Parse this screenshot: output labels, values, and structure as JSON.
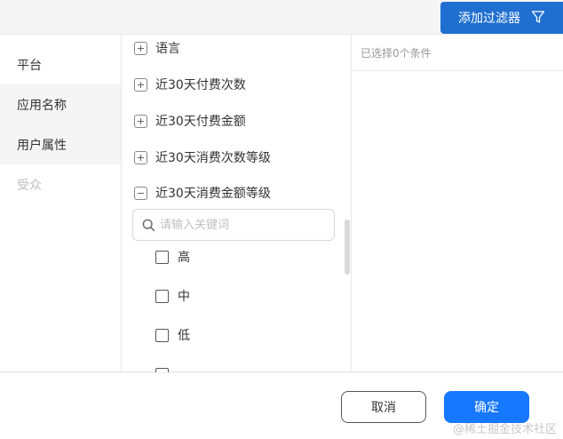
{
  "header": {
    "add_filter_label": "添加过滤器",
    "filter_icon": "filter-icon"
  },
  "categories": [
    {
      "label": "平台"
    },
    {
      "label": "应用名称"
    },
    {
      "label": "用户属性"
    },
    {
      "label": "受众"
    }
  ],
  "attributes": [
    {
      "label": "语言",
      "expanded": false
    },
    {
      "label": "近30天付费次数",
      "expanded": false
    },
    {
      "label": "近30天付费金额",
      "expanded": false
    },
    {
      "label": "近30天消费次数等级",
      "expanded": false
    },
    {
      "label": "近30天消费金额等级",
      "expanded": true
    }
  ],
  "search": {
    "placeholder": "请输入关键词",
    "value": ""
  },
  "options": [
    {
      "label": "高",
      "checked": false
    },
    {
      "label": "中",
      "checked": false
    },
    {
      "label": "低",
      "checked": false
    }
  ],
  "selected": {
    "summary": "已选择0个条件"
  },
  "footer": {
    "cancel_label": "取消",
    "confirm_label": "确定"
  },
  "watermark": "@稀土掘金技术社区",
  "colors": {
    "primary": "#1677ff",
    "header_button": "#1f6fd1"
  }
}
